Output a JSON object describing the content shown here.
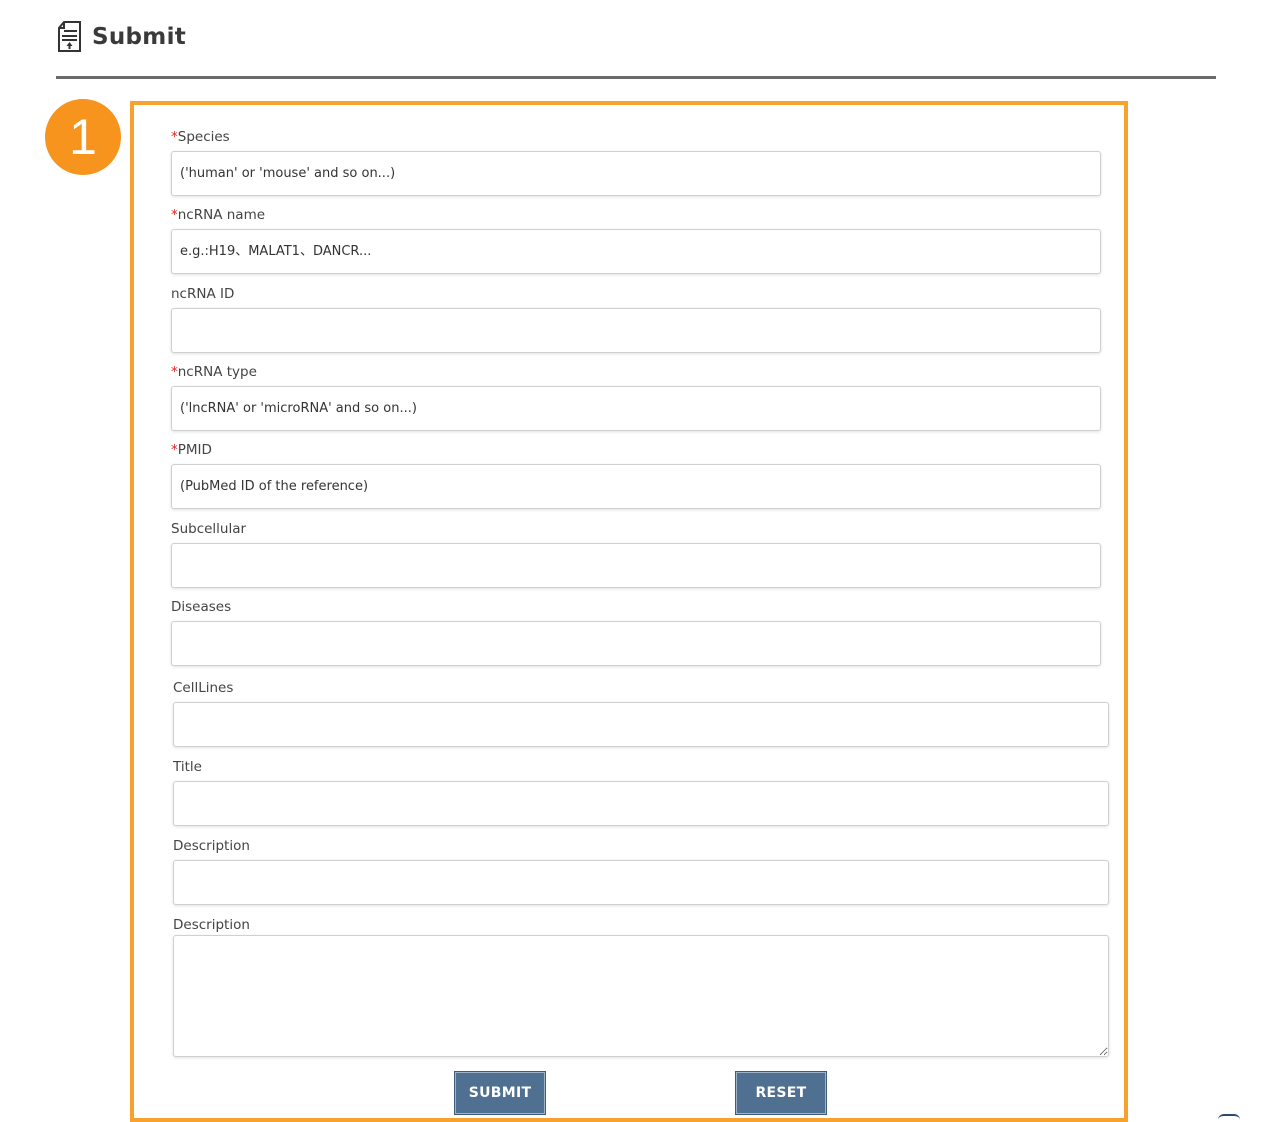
{
  "header": {
    "title": "Submit",
    "icon": "document-upload-icon"
  },
  "step": {
    "number": "1"
  },
  "colors": {
    "accent": "#f7a12f",
    "badge": "#f7941d",
    "required": "#e02020",
    "button": "#4f7091"
  },
  "form": {
    "species": {
      "required_mark": "*",
      "label": "Species",
      "placeholder": "('human' or 'mouse' and so on...)"
    },
    "ncrna_name": {
      "required_mark": "*",
      "label": "ncRNA name",
      "placeholder": "e.g.:H19、MALAT1、DANCR..."
    },
    "ncrna_id": {
      "label": "ncRNA ID",
      "placeholder": ""
    },
    "ncrna_type": {
      "required_mark": "*",
      "label": "ncRNA type",
      "placeholder": "('lncRNA' or 'microRNA' and so on...)"
    },
    "pmid": {
      "required_mark": "*",
      "label": "PMID",
      "placeholder": "(PubMed ID of the reference)"
    },
    "subcellular": {
      "label": "Subcellular",
      "placeholder": ""
    },
    "diseases": {
      "label": "Diseases",
      "placeholder": ""
    },
    "celllines": {
      "label": "CellLines",
      "placeholder": ""
    },
    "title": {
      "label": "Title",
      "placeholder": ""
    },
    "description1": {
      "label": "Description",
      "placeholder": ""
    },
    "description2": {
      "label": "Description",
      "placeholder": ""
    }
  },
  "buttons": {
    "submit": "SUBMIT",
    "reset": "RESET"
  }
}
